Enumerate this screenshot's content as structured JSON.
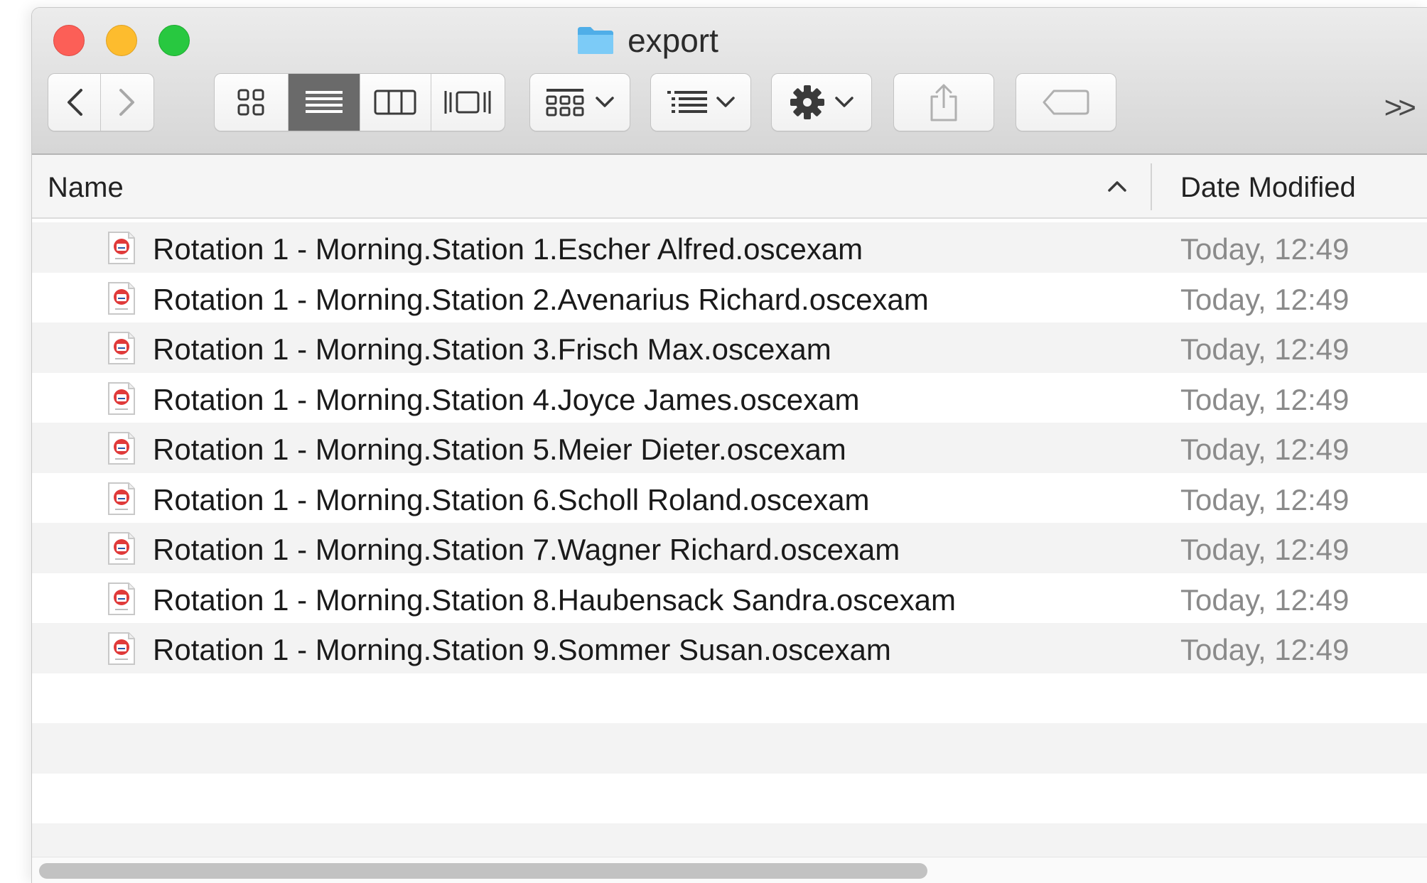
{
  "window": {
    "title": "export"
  },
  "toolbar": {
    "back_icon": "chevron-left-icon",
    "forward_icon": "chevron-right-icon",
    "view_modes": [
      "icon-view",
      "list-view",
      "column-view",
      "cover-flow-view"
    ],
    "active_view": "list-view",
    "group_menu_icon": "group-grid-icon",
    "arrange_menu_icon": "arrange-list-icon",
    "action_menu_icon": "gear-icon",
    "share_icon": "share-icon",
    "tag_icon": "tag-icon",
    "overflow_label": ">>"
  },
  "list": {
    "columns": {
      "name": "Name",
      "date_modified": "Date Modified"
    },
    "sort_direction": "ascending",
    "files": [
      {
        "name": "Rotation 1 - Morning.Station 1.Escher Alfred.oscexam",
        "date": "Today, 12:49"
      },
      {
        "name": "Rotation 1 - Morning.Station 2.Avenarius Richard.oscexam",
        "date": "Today, 12:49"
      },
      {
        "name": "Rotation 1 - Morning.Station 3.Frisch Max.oscexam",
        "date": "Today, 12:49"
      },
      {
        "name": "Rotation 1 - Morning.Station 4.Joyce James.oscexam",
        "date": "Today, 12:49"
      },
      {
        "name": "Rotation 1 - Morning.Station 5.Meier Dieter.oscexam",
        "date": "Today, 12:49"
      },
      {
        "name": "Rotation 1 - Morning.Station 6.Scholl Roland.oscexam",
        "date": "Today, 12:49"
      },
      {
        "name": "Rotation 1 - Morning.Station 7.Wagner Richard.oscexam",
        "date": "Today, 12:49"
      },
      {
        "name": "Rotation 1 - Morning.Station 8.Haubensack Sandra.oscexam",
        "date": "Today, 12:49"
      },
      {
        "name": "Rotation 1 - Morning.Station 9.Sommer Susan.oscexam",
        "date": "Today, 12:49"
      }
    ],
    "empty_rows": 4
  },
  "colors": {
    "close": "#fc5f57",
    "minimize": "#fdbc2e",
    "maximize": "#28c840",
    "folder": "#5cb8f0",
    "file_icon_accent": "#e03a3a"
  }
}
